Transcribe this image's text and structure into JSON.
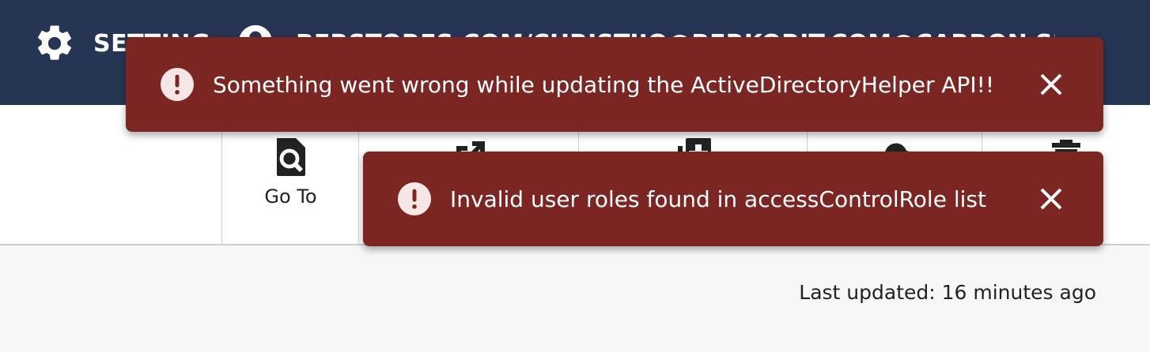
{
  "header": {
    "settings_label": "SETTINGS",
    "user_label": "BERSTORES.COM/CHRISTIJO@BERKORIT.COM@CARBON SUPER",
    "background_color": "#263554"
  },
  "toolbar": {
    "items": [
      {
        "label": "Go To",
        "icon": "file-search-icon"
      },
      {
        "label": "",
        "icon": "external-link-icon"
      },
      {
        "label": "",
        "icon": "add-copy-icon"
      },
      {
        "label": "",
        "icon": "cloud-upload-icon"
      },
      {
        "label": "",
        "icon": "trash-icon"
      }
    ]
  },
  "status": {
    "last_updated": "Last updated: 16 minutes ago"
  },
  "toasts": [
    {
      "message": "Something went wrong while updating the ActiveDirectoryHelper API!!",
      "icon": "error-icon",
      "color": "#7b2622"
    },
    {
      "message": "Invalid user roles found in accessControlRole list",
      "icon": "error-icon",
      "color": "#7b2622"
    }
  ]
}
